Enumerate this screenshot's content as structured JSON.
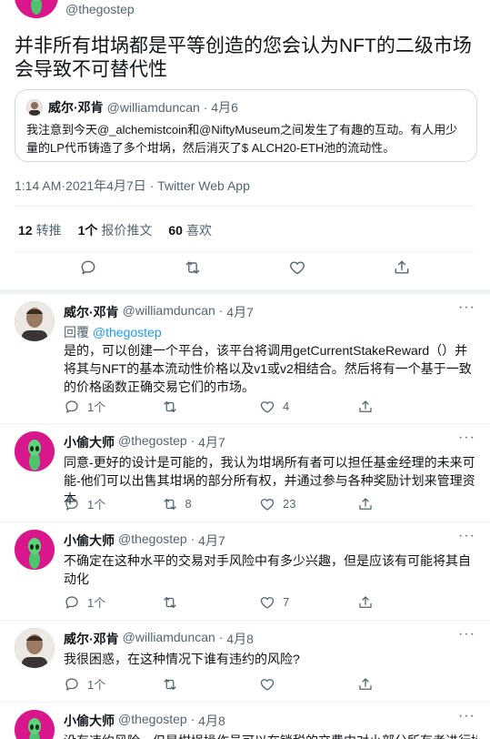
{
  "main_tweet": {
    "handle": "@thegostep",
    "text": "并非所有坩埚都是平等创造的您会认为NFT的二级市场会导致不可替代性",
    "quote": {
      "name": "威尔·邓肯",
      "handle": "@williamduncan",
      "date": "4月6",
      "text": "我注意到今天@_alchemistcoin和@NiftyMuseum之间发生了有趣的互动。有人用少量的LP代币铸造了多个坩埚，然后消灭了$ ALCH20-ETH池的流动性。"
    },
    "timestamp": "1:14 AM·2021年4月7日 · Twitter Web App",
    "stats": {
      "retweets_count": "12",
      "retweets_label": "转推",
      "quotes_count": "1个",
      "quotes_label": "报价推文",
      "likes_count": "60",
      "likes_label": "喜欢"
    }
  },
  "replies": [
    {
      "name": "威尔·邓肯",
      "handle": "@williamduncan",
      "date": "4月7",
      "replying_to_prefix": "回覆",
      "replying_to": "@thegostep",
      "text": "是的，可以创建一个平台，该平台将调用getCurrentStakeReward（）并将其与NFT的基本流动性价格以及v1或v2相结合。然后将有一个基于一致的价格函数正确交易它们的市场。",
      "reply_count": "1个",
      "retweet_count": "",
      "like_count": "4",
      "avatar": "man"
    },
    {
      "name": "小偷大师",
      "handle": "@thegostep",
      "date": "4月7",
      "text": "同意-更好的设计是可能的，我认为坩埚所有者可以担任基金经理的未来可能-他们可以出售其坩埚的部分所有权，并通过参与各种奖励计划来管理资本",
      "reply_count": "1个",
      "retweet_count": "8",
      "like_count": "23",
      "avatar": "alien"
    },
    {
      "name": "小偷大师",
      "handle": "@thegostep",
      "date": "4月7",
      "text": "不确定在这种水平的交易对手风险中有多少兴趣，但是应该有可能将其自动化",
      "reply_count": "1个",
      "retweet_count": "",
      "like_count": "7",
      "avatar": "alien"
    },
    {
      "name": "威尔·邓肯",
      "handle": "@williamduncan",
      "date": "4月8",
      "text": "我很困惑，在这种情况下谁有违约的风险?",
      "reply_count": "1个",
      "retweet_count": "",
      "like_count": "",
      "avatar": "man"
    },
    {
      "name": "小偷大师",
      "handle": "@thegostep",
      "date": "4月8",
      "text": "没有违约风险，但是坩埚操作员可以在锁税的交费中对小部分所有者进行操",
      "avatar": "alien"
    }
  ],
  "more_label": "···",
  "colors": {
    "accent": "#1d9bf0",
    "secondary_text": "#536471",
    "border": "#eff3f4",
    "alien_avatar_bg": "#d9168c"
  },
  "icons": [
    "reply-icon",
    "retweet-icon",
    "like-icon",
    "share-icon",
    "more-icon",
    "alien-avatar",
    "man-avatar"
  ]
}
